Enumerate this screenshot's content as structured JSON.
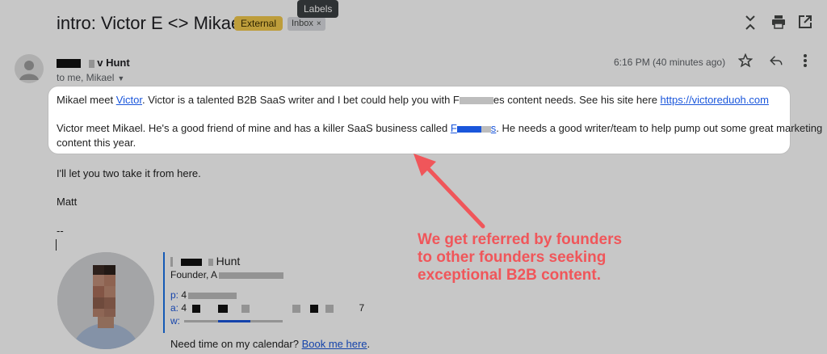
{
  "subject": "intro: Victor E <> Mikael",
  "labels": {
    "external": "External",
    "inbox": "Inbox",
    "inbox_close": "×",
    "tooltip": "Labels"
  },
  "sender": {
    "name_suffix": "v Hunt",
    "recipients": "to me, Mikael",
    "timestamp": "6:16 PM (40 minutes ago)"
  },
  "icons": [
    "collapse-icon",
    "print-icon",
    "open-in-new-icon",
    "star-icon",
    "reply-icon",
    "more-icon"
  ],
  "highlight": {
    "l1_a": "Mikael meet ",
    "l1_link": "Victor",
    "l1_b": ".  Victor is a talented B2B SaaS writer and I bet could help you with F",
    "l1_c": "es content needs.  See his site here ",
    "l1_url": "https://victoreduoh.com",
    "l2_a": "Victor meet Mikael. He's a good friend of mine and has a killer SaaS business called ",
    "l2_link_a": "F",
    "l2_link_b": "s",
    "l2_b": ".  He needs a good writer/team to help pump out some great marketing",
    "l3": "content this year."
  },
  "body": {
    "line4": "I'll let you two take it from here.",
    "line5": "Matt",
    "dash": "--"
  },
  "signature": {
    "name": "Hunt",
    "title": "Founder, A",
    "p_label": "p:",
    "p_value": "4",
    "a_label": "a:",
    "a_value": "4",
    "a_end": "7",
    "w_label": "w:",
    "cal_text": "Need time on my calendar? ",
    "cal_link": "Book me here",
    "cal_end": "."
  },
  "annotation": {
    "line1": "We get referred by founders",
    "line2": "to other founders seeking",
    "line3": "exceptional B2B content."
  },
  "colors": {
    "annotation": "#f0565a",
    "link": "#1a56db",
    "external_chip": "#f2c94c"
  }
}
